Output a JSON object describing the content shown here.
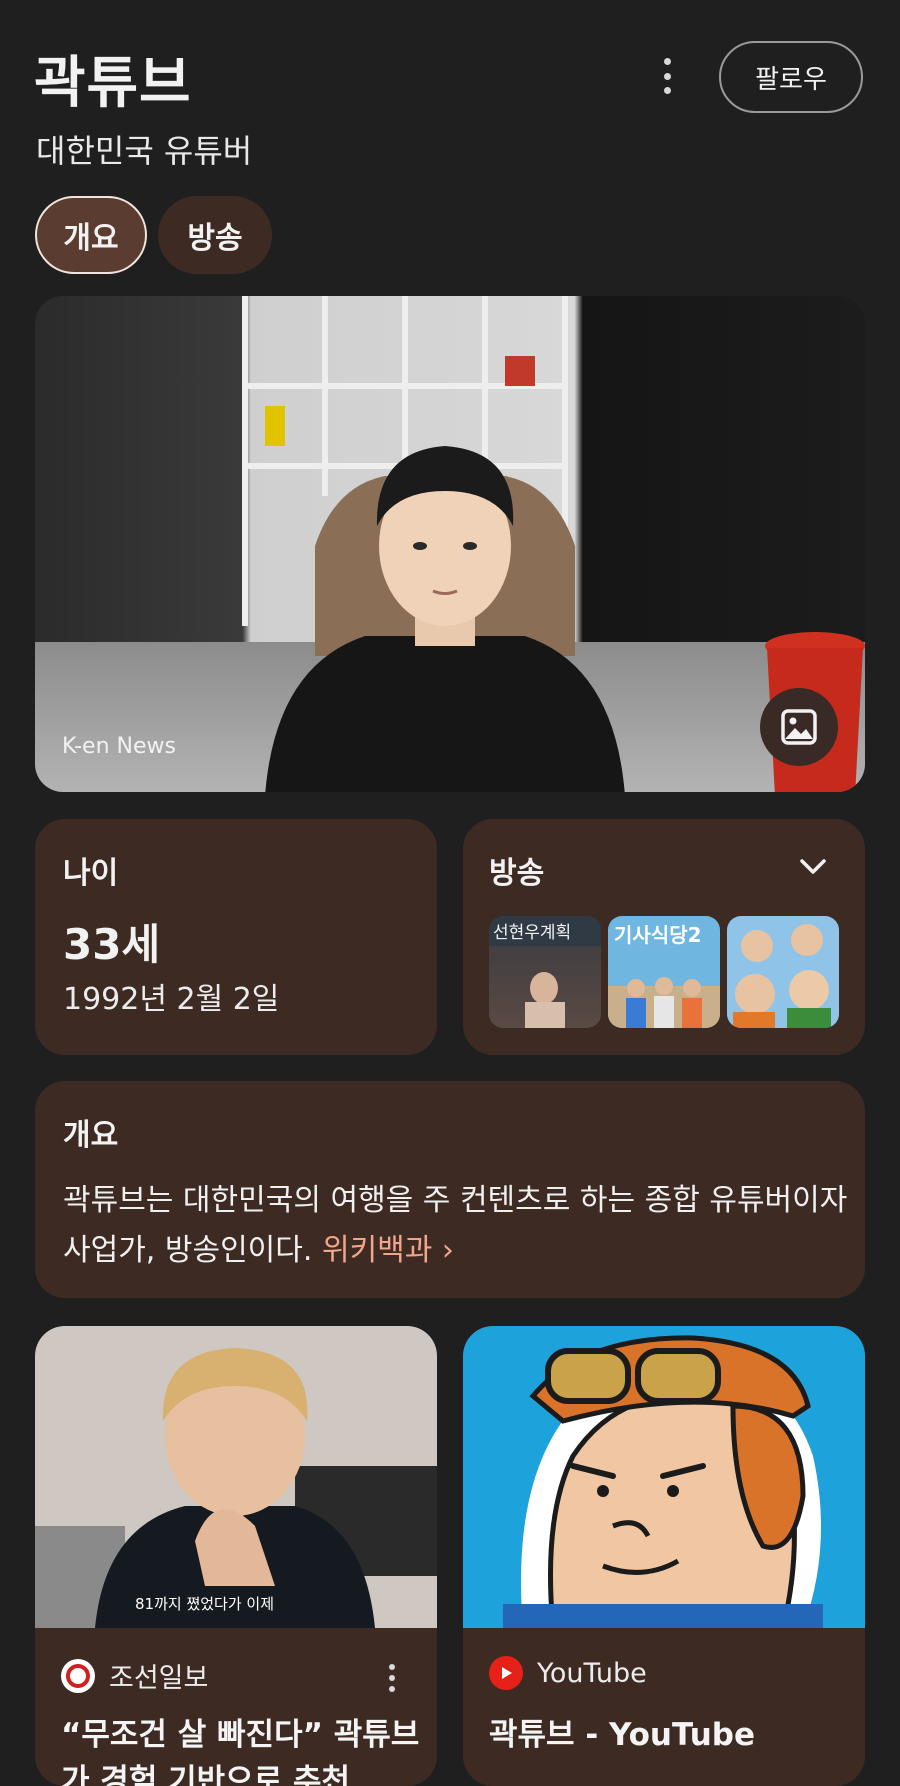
{
  "header": {
    "title": "곽튜브",
    "subtitle": "대한민국 유튜버",
    "follow_label": "팔로우"
  },
  "tabs": [
    {
      "label": "개요",
      "active": true
    },
    {
      "label": "방송",
      "active": false
    }
  ],
  "hero": {
    "credit": "K-en News",
    "icon": "image-icon"
  },
  "age_card": {
    "label": "나이",
    "value": "33세",
    "birthdate": "1992년 2월 2일"
  },
  "broadcast_card": {
    "label": "방송",
    "icon": "chevron-down-icon",
    "thumbnails": [
      {
        "caption": "선현우계획"
      },
      {
        "caption": "기사식당2"
      },
      {
        "caption": ""
      }
    ]
  },
  "overview": {
    "label": "개요",
    "text": "곽튜브는 대한민국의 여행을 주 컨텐츠로 하는 종합 유튜버이자 사업가, 방송인이다.",
    "link": "위키백과 ›"
  },
  "news": [
    {
      "source": "조선일보",
      "headline": "“무조건 살 빠진다” 곽튜브가 경험 기반으로 추천",
      "subtitle_in_image": "81까지 쪘었다가 이제"
    },
    {
      "source": "YouTube",
      "headline": "곽튜브 - YouTube"
    }
  ],
  "colors": {
    "background": "#1f1f1f",
    "card": "#3d2b23",
    "chip_active": "#5a3d30",
    "link": "#f2a58a",
    "youtube_red": "#e62117"
  }
}
